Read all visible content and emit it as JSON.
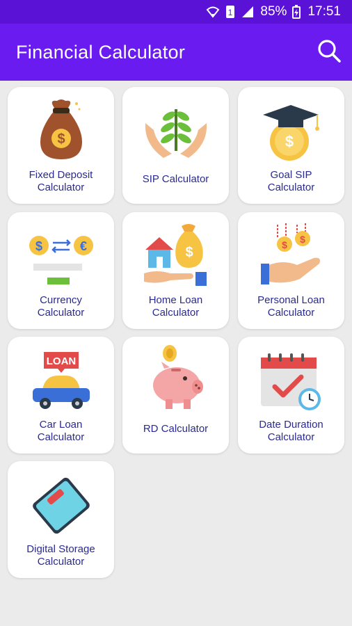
{
  "status_bar": {
    "battery": "85%",
    "time": "17:51",
    "sim_slot": "1"
  },
  "app_bar": {
    "title": "Financial Calculator"
  },
  "calculators": [
    {
      "label": "Fixed Deposit\nCalculator"
    },
    {
      "label": "SIP Calculator"
    },
    {
      "label": "Goal SIP\nCalculator"
    },
    {
      "label": "Currency\nCalculator"
    },
    {
      "label": "Home Loan\nCalculator"
    },
    {
      "label": "Personal Loan\nCalculator"
    },
    {
      "label": "Car Loan\nCalculator"
    },
    {
      "label": "RD Calculator"
    },
    {
      "label": "Date Duration\nCalculator"
    },
    {
      "label": "Digital Storage\nCalculator"
    }
  ],
  "icon_text": {
    "loan_sign": "LOAN",
    "currency_left": "$",
    "currency_right": "€",
    "dollar": "$"
  },
  "colors": {
    "status_bar": "#5a12d6",
    "app_bar": "#6a1bf0",
    "label": "#2a2a8f",
    "background": "#ebebeb"
  }
}
